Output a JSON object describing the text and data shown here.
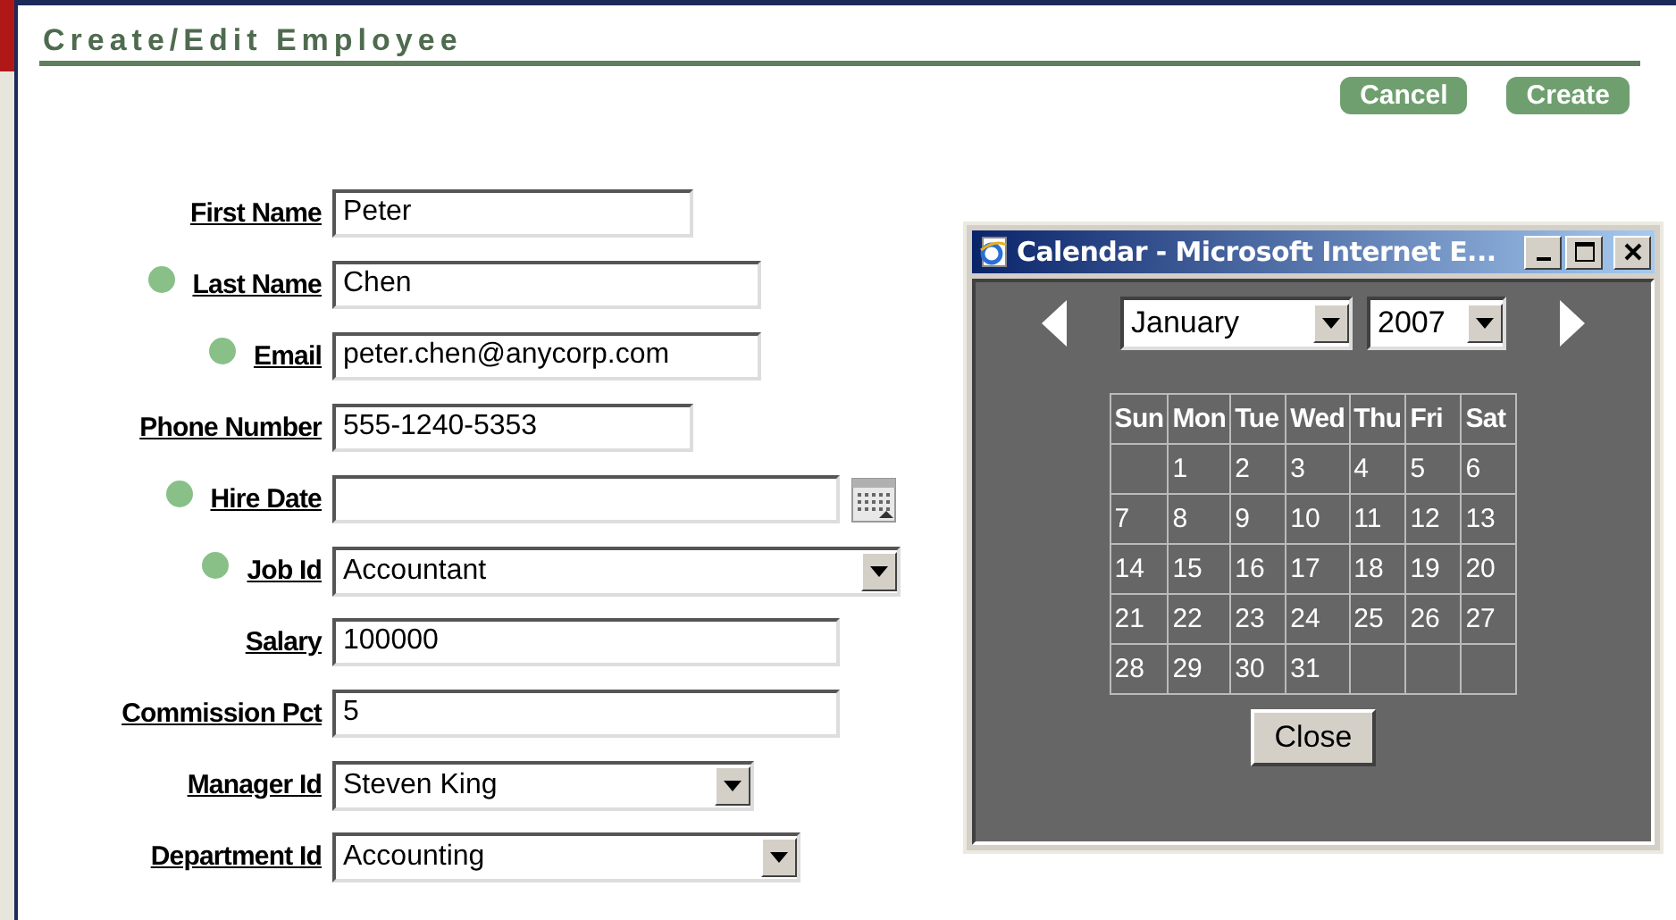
{
  "page": {
    "title": "Create/Edit Employee",
    "buttons": [
      "Cancel",
      "Create"
    ]
  },
  "fields": [
    {
      "label": "First Name",
      "kind": "text",
      "required": false,
      "value": "Peter"
    },
    {
      "label": "Last Name",
      "kind": "text",
      "required": true,
      "value": "Chen"
    },
    {
      "label": "Email",
      "kind": "text",
      "required": true,
      "value": "peter.chen@anycorp.com"
    },
    {
      "label": "Phone Number",
      "kind": "text",
      "required": false,
      "value": "555-1240-5353"
    },
    {
      "label": "Hire Date",
      "kind": "date",
      "required": true
    },
    {
      "label": "Job Id",
      "kind": "select",
      "required": true,
      "value": "Accountant"
    },
    {
      "label": "Salary",
      "kind": "text",
      "required": false,
      "value": "100000"
    },
    {
      "label": "Commission Pct",
      "kind": "text",
      "required": false,
      "value": "5"
    },
    {
      "label": "Manager Id",
      "kind": "select",
      "required": false,
      "value": "Steven King"
    },
    {
      "label": "Department Id",
      "kind": "select",
      "required": false,
      "value": "Accounting"
    }
  ],
  "calendar_window": {
    "title": "Calendar - Microsoft Internet E...",
    "month": "January",
    "year": "2007",
    "weekdays": [
      "Sun",
      "Mon",
      "Tue",
      "Wed",
      "Thu",
      "Fri",
      "Sat"
    ],
    "weeks": [
      [
        "1",
        "2",
        "3",
        "4",
        "5",
        "6"
      ],
      [
        "7",
        "8",
        "9",
        "10",
        "11",
        "12",
        "13"
      ],
      [
        "14",
        "15",
        "16",
        "17",
        "18",
        "19",
        "20"
      ],
      [
        "21",
        "22",
        "23",
        "24",
        "25",
        "26",
        "27"
      ],
      [
        "28",
        "29",
        "30",
        "31"
      ]
    ],
    "close_button": "Close"
  }
}
